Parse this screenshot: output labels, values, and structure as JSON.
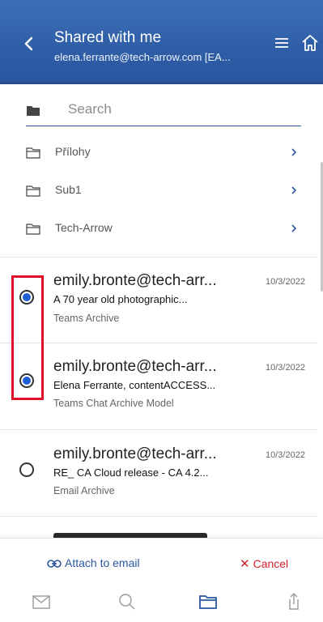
{
  "header": {
    "title": "Shared with me",
    "subtitle": "elena.ferrante@tech-arrow.com [EA..."
  },
  "search": {
    "placeholder": "Search"
  },
  "folders": [
    {
      "label": "Přílohy"
    },
    {
      "label": "Sub1"
    },
    {
      "label": "Tech-Arrow"
    }
  ],
  "items": [
    {
      "sender": "emily.bronte@tech-arr...",
      "date": "10/3/2022",
      "subject": "A 70 year old photographic...",
      "source": "Teams Archive",
      "selected": true
    },
    {
      "sender": "emily.bronte@tech-arr...",
      "date": "10/3/2022",
      "subject": "Elena Ferrante, contentACCESS...",
      "source": "Teams Chat Archive Model",
      "selected": true
    },
    {
      "sender": "emily.bronte@tech-arr...",
      "date": "10/3/2022",
      "subject": "RE_ CA Cloud release - CA 4.2...",
      "source": "Email Archive",
      "selected": false
    }
  ],
  "actions": {
    "attach_label": "Attach to email",
    "cancel_label": "Cancel"
  },
  "colors": {
    "header_bg": "#2f5ea6",
    "accent": "#2a56a0",
    "radio_selected": "#1e5fd6",
    "cancel": "#d61f2b",
    "highlight": "#e0102a"
  },
  "nav": {
    "icons": [
      "mail-icon",
      "search-icon",
      "folder-icon",
      "share-icon"
    ],
    "active": "folder-icon"
  }
}
